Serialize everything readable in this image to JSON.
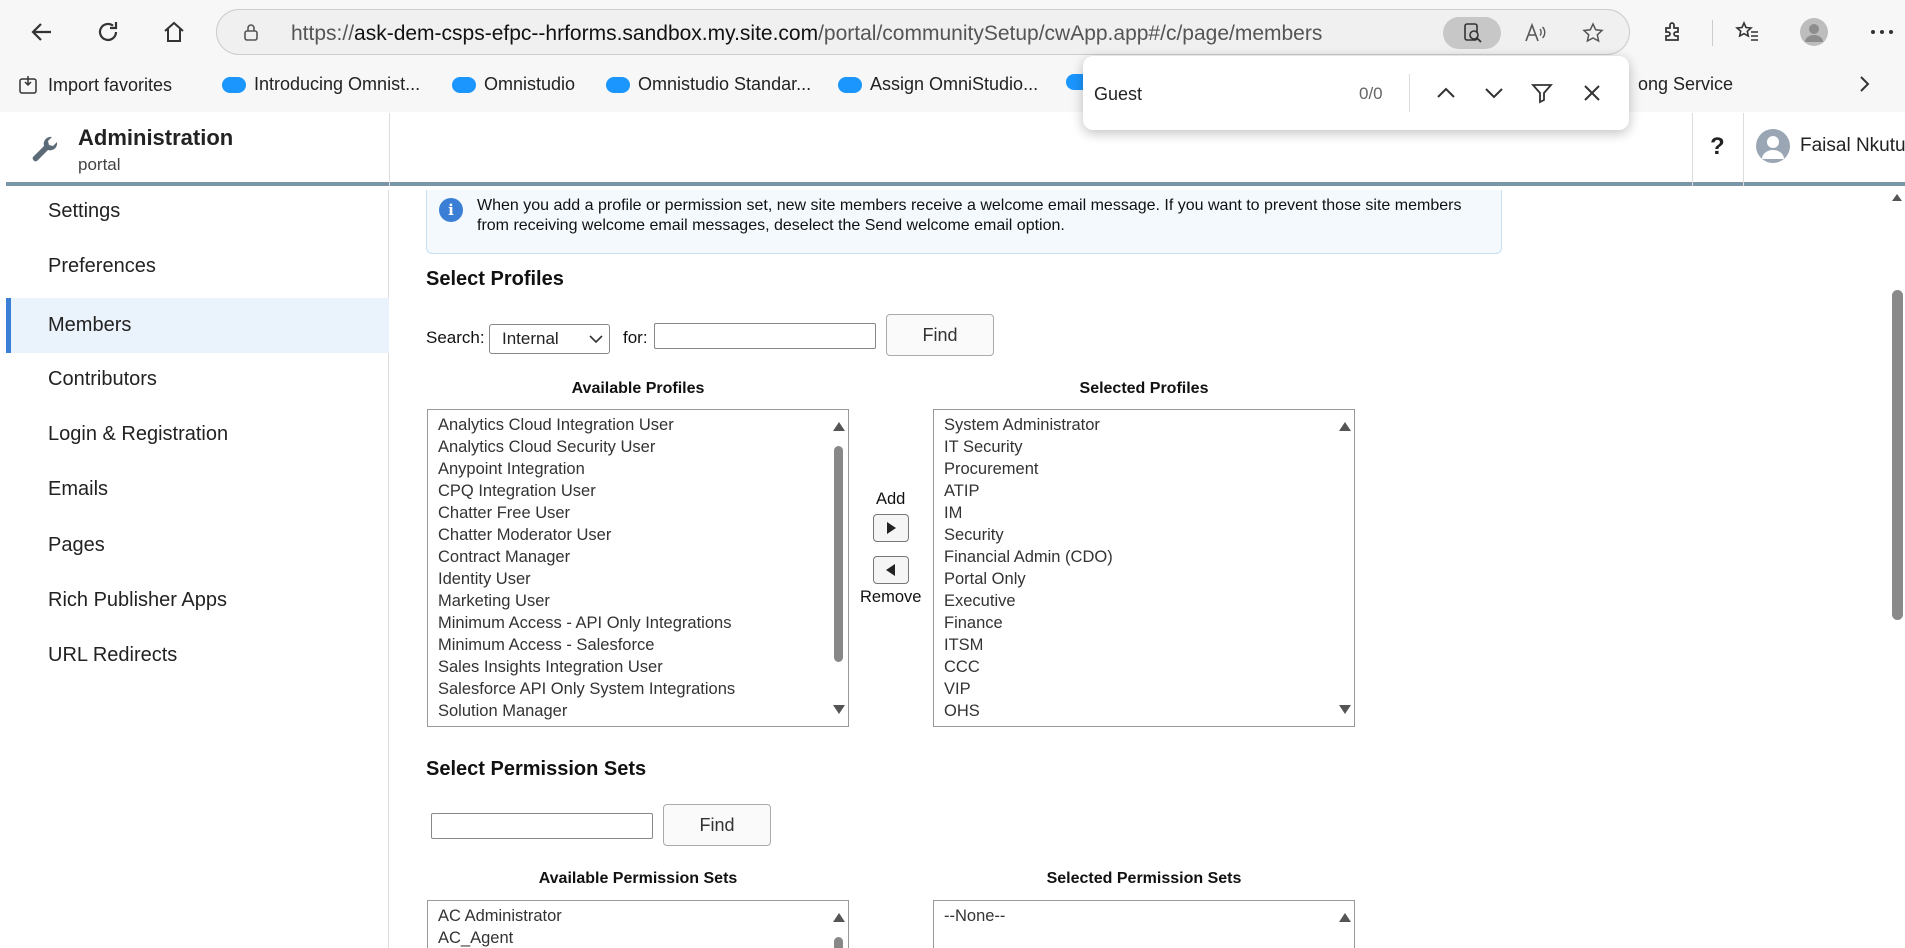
{
  "browser": {
    "url_prefix": "https://",
    "url_host": "ask-dem-csps-efpc--hrforms.sandbox.my.site.com",
    "url_path": "/portal/communitySetup/cwApp.app#/c/page/members",
    "bookmarks": [
      "Import favorites",
      "Introducing Omnist...",
      "Omnistudio",
      "Omnistudio Standar...",
      "Assign OmniStudio...",
      "ong Service"
    ]
  },
  "find": {
    "query": "Guest",
    "count": "0/0"
  },
  "header": {
    "title": "Administration",
    "subtitle": "portal",
    "help": "?",
    "user_name": "Faisal Nkutu"
  },
  "sidebar": {
    "items": [
      {
        "label": "Settings"
      },
      {
        "label": "Preferences"
      },
      {
        "label": "Members"
      },
      {
        "label": "Contributors"
      },
      {
        "label": "Login & Registration"
      },
      {
        "label": "Emails"
      },
      {
        "label": "Pages"
      },
      {
        "label": "Rich Publisher Apps"
      },
      {
        "label": "URL Redirects"
      }
    ],
    "active": "Members"
  },
  "info": {
    "text": "When you add a profile or permission set, new site members receive a welcome email message. If you want to prevent those site members from receiving welcome email messages, deselect the Send welcome email option."
  },
  "profiles": {
    "title": "Select Profiles",
    "search_label": "Search:",
    "search_value": "Internal",
    "for_label": "for:",
    "find_label": "Find",
    "available_head": "Available Profiles",
    "selected_head": "Selected Profiles",
    "available": [
      "Analytics Cloud Integration User",
      "Analytics Cloud Security User",
      "Anypoint Integration",
      "CPQ Integration User",
      "Chatter Free User",
      "Chatter Moderator User",
      "Contract Manager",
      "Identity User",
      "Marketing User",
      "Minimum Access - API Only Integrations",
      "Minimum Access - Salesforce",
      "Sales Insights Integration User",
      "Salesforce API Only System Integrations",
      "Solution Manager"
    ],
    "selected": [
      "System Administrator",
      "IT Security",
      "Procurement",
      "ATIP",
      "IM",
      "Security",
      "Financial Admin (CDO)",
      "Portal Only",
      "Executive",
      "Finance",
      "ITSM",
      "CCC",
      "VIP",
      "OHS"
    ],
    "add_label": "Add",
    "remove_label": "Remove"
  },
  "permsets": {
    "title": "Select Permission Sets",
    "find_label": "Find",
    "available_head": "Available Permission Sets",
    "selected_head": "Selected Permission Sets",
    "available": [
      "AC Administrator",
      "AC_Agent"
    ],
    "selected": [
      "--None--"
    ]
  },
  "colors": {
    "accent": "#3a7fd5",
    "header_border": "#7a95a8",
    "active_bg": "#eaf2fb"
  }
}
